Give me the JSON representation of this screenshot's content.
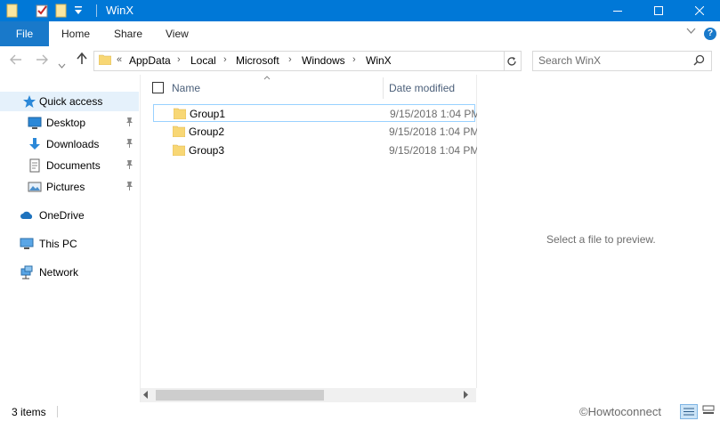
{
  "window": {
    "title": "WinX",
    "controls": {
      "minimize_icon": "minimize-icon",
      "maximize_icon": "maximize-icon",
      "close_icon": "close-icon"
    }
  },
  "quick_access_toolbar": {
    "icons": [
      "folder-icon",
      "properties-icon",
      "new-folder-icon",
      "customize-dropdown-icon"
    ]
  },
  "ribbon": {
    "file_label": "File",
    "tabs": [
      "Home",
      "Share",
      "View"
    ],
    "accent": "#1979ca"
  },
  "address": {
    "overflow": "«",
    "crumbs": [
      "AppData",
      "Local",
      "Microsoft",
      "Windows",
      "WinX"
    ]
  },
  "search": {
    "placeholder": "Search WinX"
  },
  "sidebar": {
    "items": [
      {
        "label": "Quick access",
        "icon": "star-icon",
        "selected": true
      },
      {
        "label": "Desktop",
        "icon": "desktop-icon",
        "pinned": true
      },
      {
        "label": "Downloads",
        "icon": "download-icon",
        "pinned": true
      },
      {
        "label": "Documents",
        "icon": "documents-icon",
        "pinned": true
      },
      {
        "label": "Pictures",
        "icon": "pictures-icon",
        "pinned": true
      },
      {
        "label": "OneDrive",
        "icon": "cloud-icon"
      },
      {
        "label": "This PC",
        "icon": "computer-icon"
      },
      {
        "label": "Network",
        "icon": "network-icon"
      }
    ]
  },
  "content": {
    "columns": [
      "Name",
      "Date modified"
    ],
    "rows": [
      {
        "name": "Group1",
        "date": "9/15/2018 1:04 PM",
        "selected": true
      },
      {
        "name": "Group2",
        "date": "9/15/2018 1:04 PM"
      },
      {
        "name": "Group3",
        "date": "9/15/2018 1:04 PM"
      }
    ]
  },
  "preview": {
    "text": "Select a file to preview."
  },
  "status": {
    "count": "3 items",
    "watermark": "©Howtoconnect"
  },
  "colors": {
    "titlebar": "#0078d7",
    "folder": "#f8d775",
    "selection_border": "#99d1ff",
    "hover_bg": "#e5f1fb"
  }
}
